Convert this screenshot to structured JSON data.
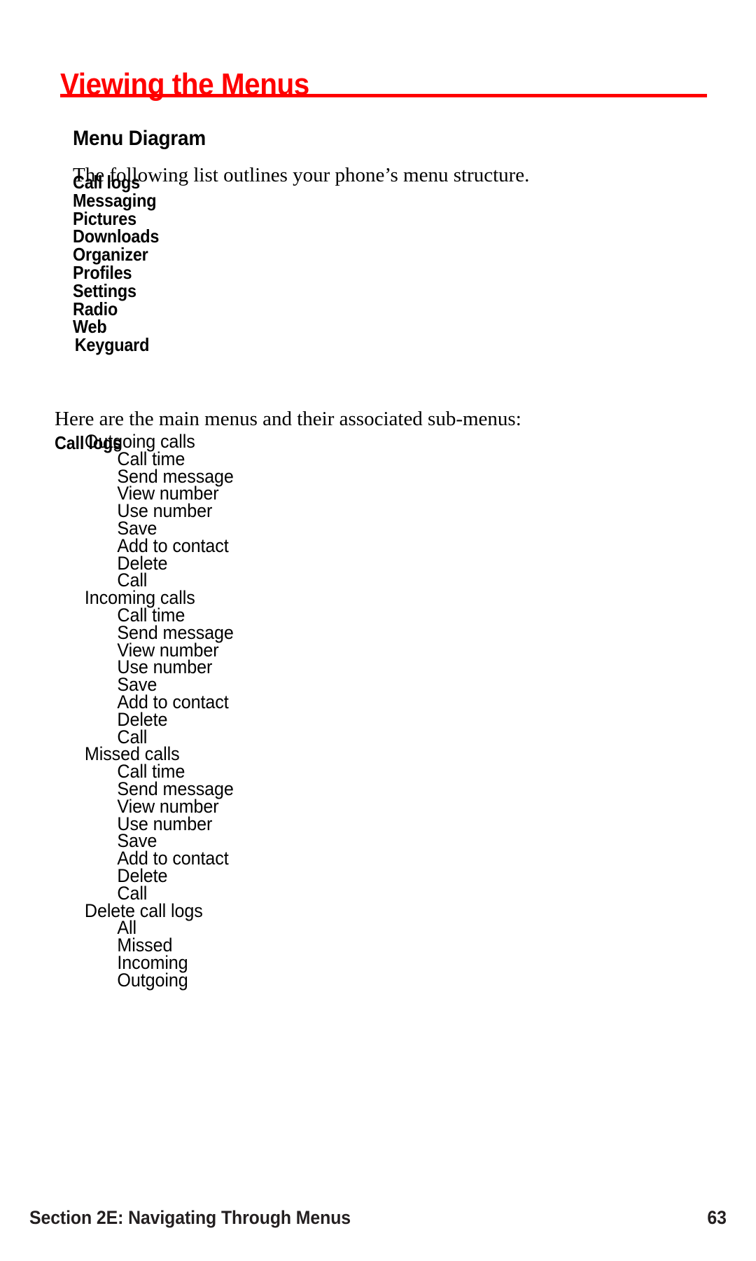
{
  "page": {
    "title": "Viewing the Menus",
    "accent_color": "#ff0000",
    "text_color": "#000000"
  },
  "section": {
    "heading": "Menu Diagram",
    "intro_one": "The following list outlines your phone’s menu structure.",
    "intro_two": "Here are the main menus and their associated sub-menus:"
  },
  "menu_list": [
    {
      "label": "Call logs"
    },
    {
      "label": "Messaging"
    },
    {
      "label": "Pictures"
    },
    {
      "label": "Downloads"
    },
    {
      "label": "Organizer"
    },
    {
      "label": "Profiles"
    },
    {
      "label": "Settings"
    },
    {
      "label": "Radio"
    },
    {
      "label": "Web"
    },
    {
      "label": "Keyguard"
    }
  ],
  "tree": {
    "heading": "Call logs",
    "items": [
      {
        "level": 1,
        "label": "Outgoing calls"
      },
      {
        "level": 2,
        "label": "Call time"
      },
      {
        "level": 2,
        "label": "Send message"
      },
      {
        "level": 2,
        "label": "View number"
      },
      {
        "level": 2,
        "label": "Use number"
      },
      {
        "level": 2,
        "label": "Save"
      },
      {
        "level": 2,
        "label": "Add to contact"
      },
      {
        "level": 2,
        "label": "Delete"
      },
      {
        "level": 2,
        "label": "Call"
      },
      {
        "level": 1,
        "label": "Incoming calls"
      },
      {
        "level": 2,
        "label": "Call time"
      },
      {
        "level": 2,
        "label": "Send message"
      },
      {
        "level": 2,
        "label": "View number"
      },
      {
        "level": 2,
        "label": "Use number"
      },
      {
        "level": 2,
        "label": "Save"
      },
      {
        "level": 2,
        "label": "Add to contact"
      },
      {
        "level": 2,
        "label": "Delete"
      },
      {
        "level": 2,
        "label": "Call"
      },
      {
        "level": 1,
        "label": "Missed calls"
      },
      {
        "level": 2,
        "label": "Call time"
      },
      {
        "level": 2,
        "label": "Send message"
      },
      {
        "level": 2,
        "label": "View number"
      },
      {
        "level": 2,
        "label": "Use number"
      },
      {
        "level": 2,
        "label": "Save"
      },
      {
        "level": 2,
        "label": "Add to contact"
      },
      {
        "level": 2,
        "label": "Delete"
      },
      {
        "level": 2,
        "label": "Call"
      },
      {
        "level": 1,
        "label": "Delete call logs"
      },
      {
        "level": 2,
        "label": "All"
      },
      {
        "level": 2,
        "label": "Missed"
      },
      {
        "level": 2,
        "label": "Incoming"
      },
      {
        "level": 2,
        "label": "Outgoing"
      }
    ]
  },
  "footer": {
    "section_label": "Section 2E: Navigating Through Menus",
    "page_number": "63"
  }
}
